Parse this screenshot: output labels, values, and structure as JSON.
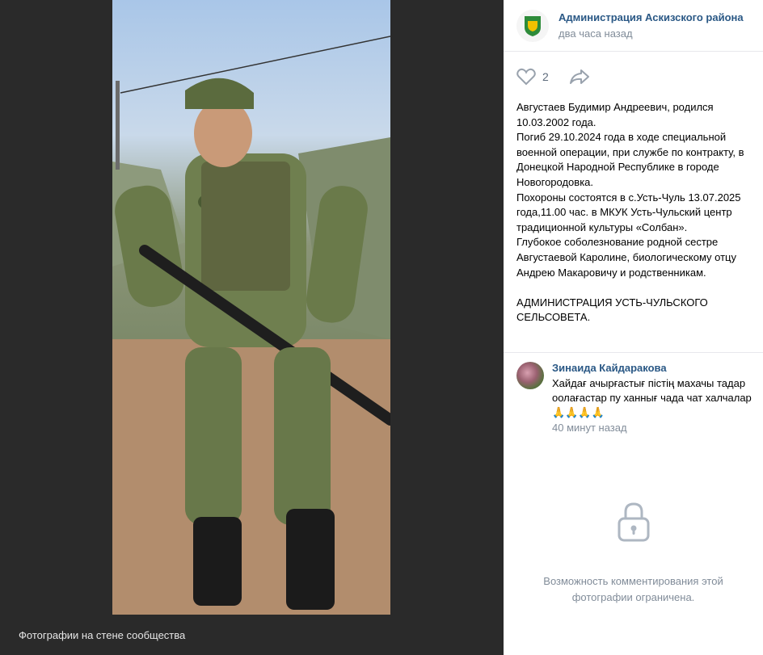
{
  "viewer": {
    "caption": "Фотографии на стене сообщества"
  },
  "post": {
    "author": "Администрация Аскизского района",
    "time": "два часа назад",
    "likes": "2",
    "text": "Августаев Будимир Андреевич, родился 10.03.2002 года.\nПогиб 29.10.2024 года в ходе специальной военной операции, при службе по контракту, в Донецкой Народной Республике в городе Новогородовка.\nПохороны состоятся в с.Усть-Чуль 13.07.2025 года,11.00 час. в МКУК Усть-Чульский центр традиционной культуры «Солбан».\nГлубокое соболезнование родной сестре Августаевой Каролине, биологическому отцу Андрею Макаровичу и родственникам.\n\nАДМИНИСТРАЦИЯ УСТЬ-ЧУЛЬСКОГО СЕЛЬСОВЕТА."
  },
  "comment": {
    "author": "Зинаида Кайдаракова",
    "text": "Хайдағ ачырғастығ пiстiң махачы тадар оолағастар пу ханнығ чада чат халчалар 🙏🙏🙏🙏",
    "time": "40 минут назад"
  },
  "restricted": {
    "text": "Возможность комментирования этой фотографии ограничена."
  },
  "icons": [
    "heart-icon",
    "share-icon",
    "lock-icon",
    "coat-of-arms-logo"
  ],
  "colors": {
    "link": "#2a5885",
    "muted": "#818c99",
    "viewer_bg": "#2a2a2a",
    "logo_green": "#2e8b3a"
  }
}
